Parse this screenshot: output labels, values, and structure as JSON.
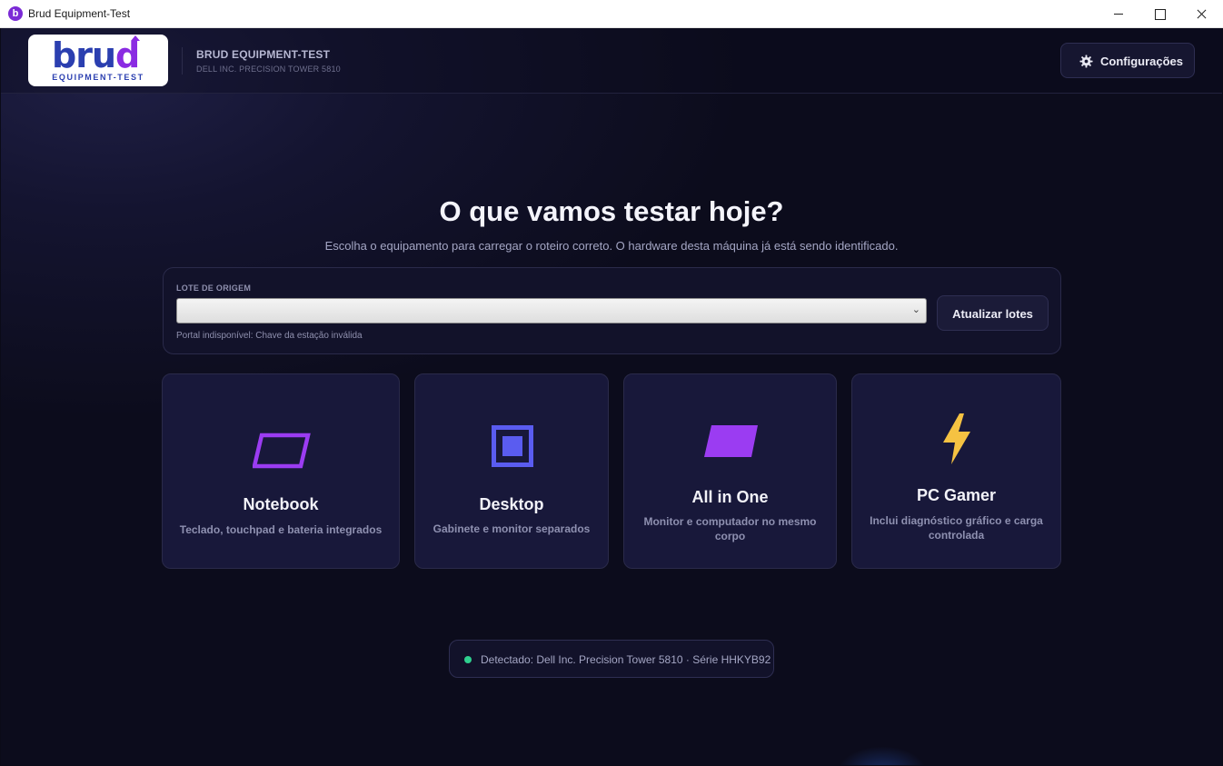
{
  "window": {
    "title": "Brud Equipment-Test",
    "icon_letter": "b"
  },
  "header": {
    "logo_word_main": "bru",
    "logo_word_accent": "d",
    "logo_subtitle": "EQUIPMENT-TEST",
    "app_title": "BRUD EQUIPMENT-TEST",
    "machine": "DELL INC. PRECISION TOWER 5810",
    "settings_icon": "gear-icon",
    "settings_label": "Configurações"
  },
  "hero": {
    "title": "O que vamos testar hoje?",
    "subtitle": "Escolha o equipamento para carregar o roteiro correto. O hardware desta máquina já está sendo identificado."
  },
  "lot": {
    "label": "LOTE DE ORIGEM",
    "selected_value": "",
    "error": "Portal indisponível: Chave da estação inválida",
    "refresh_label": "Atualizar lotes"
  },
  "cards": [
    {
      "title": "Notebook",
      "desc": "Teclado, touchpad e bateria integrados",
      "icon": "laptop-outline-icon",
      "color": "#9b3cf2"
    },
    {
      "title": "Desktop",
      "desc": "Gabinete e monitor separados",
      "icon": "desktop-square-icon",
      "color": "#5a5cf0"
    },
    {
      "title": "All in One",
      "desc": "Monitor e computador no mesmo corpo",
      "icon": "monitor-filled-icon",
      "color": "#9b3cf2"
    },
    {
      "title": "PC Gamer",
      "desc": "Inclui diagnóstico gráfico e carga controlada",
      "icon": "lightning-bolt-icon",
      "color": "#f5c242"
    }
  ],
  "detected": {
    "text": "Detectado: Dell Inc. Precision Tower 5810 · Série HHKYB92",
    "status_color": "#2fd08f"
  }
}
